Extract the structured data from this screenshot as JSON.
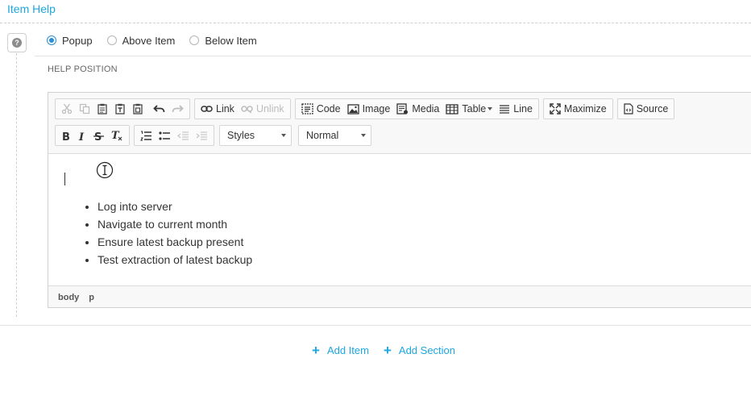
{
  "section": {
    "title": "Item Help"
  },
  "help_icon": {
    "glyph": "?",
    "icon": "question-icon"
  },
  "position": {
    "label": "HELP POSITION",
    "options": [
      {
        "label": "Popup",
        "selected": true
      },
      {
        "label": "Above Item",
        "selected": false
      },
      {
        "label": "Below Item",
        "selected": false
      }
    ]
  },
  "toolbar": {
    "link": "Link",
    "unlink": "Unlink",
    "code": "Code",
    "image": "Image",
    "media": "Media",
    "table": "Table",
    "line": "Line",
    "maximize": "Maximize",
    "source": "Source",
    "styles_select": "Styles",
    "format_select": "Normal"
  },
  "editor": {
    "list_items": [
      "Log into server",
      "Navigate to current month",
      "Ensure latest backup present",
      "Test extraction of latest backup"
    ],
    "path": [
      "body",
      "p"
    ]
  },
  "actions": {
    "add_item": "Add Item",
    "add_section": "Add Section"
  },
  "colors": {
    "accent": "#1fa6de",
    "radio_selected": "#2a8fd8"
  }
}
